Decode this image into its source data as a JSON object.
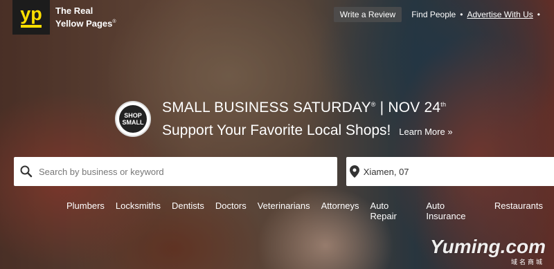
{
  "header": {
    "logo": "yp",
    "brand_line1": "The Real",
    "brand_line2": "Yellow Pages",
    "brand_mark": "®",
    "write_review": "Write a Review",
    "find_people": "Find People",
    "advertise": "Advertise With Us",
    "separator": "•"
  },
  "promo": {
    "badge_line1": "SHOP",
    "badge_line2": "SMALL",
    "title_part1": "SMALL BUSINESS SATURDAY",
    "title_reg": "®",
    "title_part2": " | NOV 24",
    "title_sup": "th",
    "subtitle": "Support Your Favorite Local Shops!",
    "learn_more": "Learn More »"
  },
  "search": {
    "placeholder": "Search by business or keyword",
    "location_value": "Xiamen, 07"
  },
  "categories": [
    "Plumbers",
    "Locksmiths",
    "Dentists",
    "Doctors",
    "Veterinarians",
    "Attorneys",
    "Auto Repair",
    "Auto Insurance",
    "Restaurants"
  ],
  "watermark": {
    "text": "Yuming.com",
    "sub": "域名商城"
  },
  "colors": {
    "brand_yellow": "#ffdf00",
    "logo_bg": "#1c1c1c"
  }
}
